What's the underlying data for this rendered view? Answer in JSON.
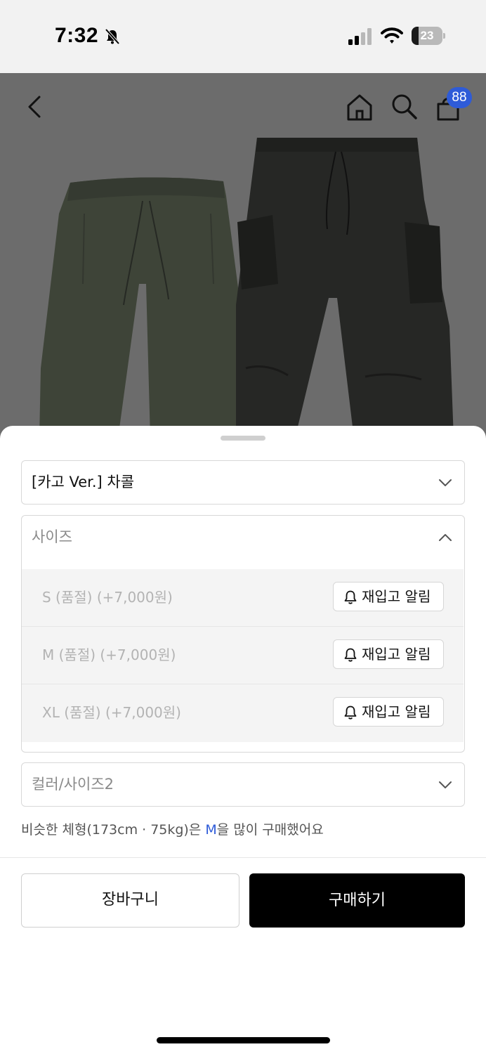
{
  "status_bar": {
    "time": "7:32",
    "battery": "23",
    "battery_level": 0.23
  },
  "header": {
    "cart_badge": "88",
    "icons": [
      "back-icon",
      "home-icon",
      "search-icon",
      "shopping-bag-icon"
    ]
  },
  "options": {
    "color": {
      "selected": "[카고 Ver.] 차콜",
      "expanded": false
    },
    "size": {
      "placeholder": "사이즈",
      "expanded": true,
      "items": [
        {
          "label": "S (품절) (+7,000원)",
          "button": "재입고 알림"
        },
        {
          "label": "M (품절) (+7,000원)",
          "button": "재입고 알림"
        },
        {
          "label": "XL (품절) (+7,000원)",
          "button": "재입고 알림"
        }
      ]
    },
    "color_size2": {
      "placeholder": "컬러/사이즈2",
      "expanded": false
    }
  },
  "recommendation": {
    "prefix": "비슷한 체형(173cm · 75kg)은 ",
    "size": "M",
    "suffix": "을 많이 구매했어요"
  },
  "actions": {
    "cart": "장바구니",
    "buy": "구매하기"
  },
  "colors": {
    "accent": "#2e5bd8",
    "buy_button": "#000000",
    "overlay": "#6c6c6c"
  }
}
